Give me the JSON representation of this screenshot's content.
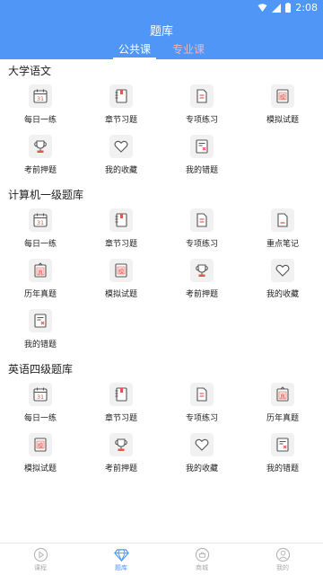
{
  "status_bar": {
    "time": "2:08"
  },
  "header": {
    "title": "题库",
    "tabs": [
      {
        "label": "公共课",
        "active": true
      },
      {
        "label": "专业课",
        "active": false
      }
    ]
  },
  "sections": [
    {
      "title": "大学语文",
      "items": [
        {
          "label": "每日一练",
          "icon": "calendar-icon"
        },
        {
          "label": "章节习题",
          "icon": "notebook-icon"
        },
        {
          "label": "专项练习",
          "icon": "document-list-icon"
        },
        {
          "label": "模拟试题",
          "icon": "mock-exam-icon"
        },
        {
          "label": "考前押题",
          "icon": "trophy-icon"
        },
        {
          "label": "我的收藏",
          "icon": "heart-icon"
        },
        {
          "label": "我的错题",
          "icon": "wrong-questions-icon"
        }
      ]
    },
    {
      "title": "计算机一级题库",
      "items": [
        {
          "label": "每日一练",
          "icon": "calendar-icon"
        },
        {
          "label": "章节习题",
          "icon": "notebook-icon"
        },
        {
          "label": "专项练习",
          "icon": "document-list-icon"
        },
        {
          "label": "重点笔记",
          "icon": "note-icon"
        },
        {
          "label": "历年真题",
          "icon": "past-exam-icon"
        },
        {
          "label": "模拟试题",
          "icon": "mock-exam-icon"
        },
        {
          "label": "考前押题",
          "icon": "trophy-icon"
        },
        {
          "label": "我的收藏",
          "icon": "heart-icon"
        },
        {
          "label": "我的错题",
          "icon": "wrong-questions-icon"
        }
      ]
    },
    {
      "title": "英语四级题库",
      "items": [
        {
          "label": "每日一练",
          "icon": "calendar-icon"
        },
        {
          "label": "章节习题",
          "icon": "notebook-icon"
        },
        {
          "label": "专项练习",
          "icon": "document-list-icon"
        },
        {
          "label": "历年真题",
          "icon": "past-exam-icon"
        },
        {
          "label": "模拟试题",
          "icon": "mock-exam-icon"
        },
        {
          "label": "考前押题",
          "icon": "trophy-icon"
        },
        {
          "label": "我的收藏",
          "icon": "heart-icon"
        },
        {
          "label": "我的错题",
          "icon": "wrong-questions-icon"
        }
      ]
    }
  ],
  "icon_text": {
    "calendar": "31",
    "mock": "模",
    "past": "真"
  },
  "bottom_nav": [
    {
      "label": "课程",
      "icon": "play-circle-icon",
      "active": false
    },
    {
      "label": "题库",
      "icon": "diamond-icon",
      "active": true
    },
    {
      "label": "商城",
      "icon": "shop-icon",
      "active": false
    },
    {
      "label": "我的",
      "icon": "user-icon",
      "active": false
    }
  ],
  "colors": {
    "primary": "#4f96f7",
    "accent_red": "#e2574c",
    "inactive_tab": "#f3b4b4",
    "icon_bg": "#f1f1f1"
  }
}
